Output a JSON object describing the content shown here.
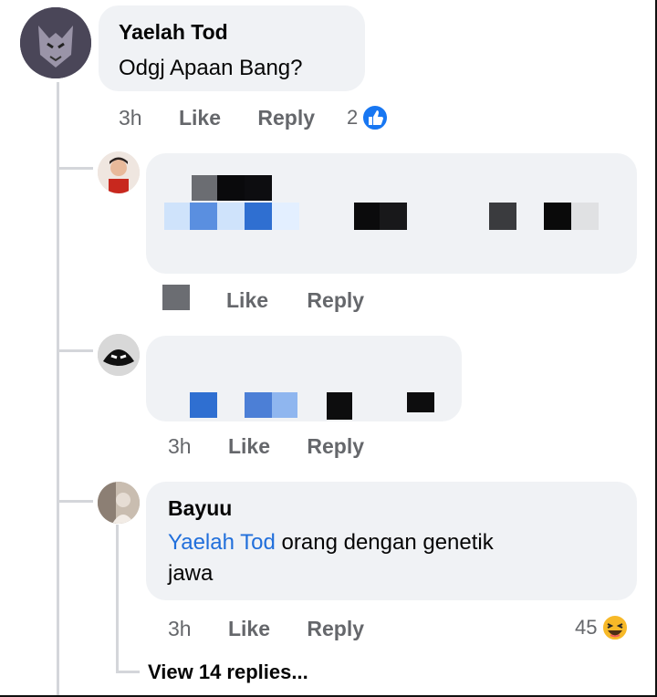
{
  "comments": {
    "top": {
      "author": "Yaelah Tod",
      "text": "Odgj Apaan Bang?",
      "time": "3h",
      "like": "Like",
      "reply": "Reply",
      "reactions": "2"
    },
    "reply1": {
      "like": "Like",
      "reply": "Reply"
    },
    "reply2": {
      "time": "3h",
      "like": "Like",
      "reply": "Reply"
    },
    "reply3": {
      "author": "Bayuu",
      "mention": "Yaelah Tod",
      "text_line1": " orang dengan genetik",
      "text_line2": "jawa",
      "time": "3h",
      "like": "Like",
      "reply": "Reply",
      "reactions": "45"
    },
    "view_more": "View 14 replies..."
  },
  "colors": {
    "like_blue": "#1877f2",
    "haha_yellow": "#f7b928",
    "bubble": "#f0f2f5",
    "mention": "#216fdb"
  }
}
